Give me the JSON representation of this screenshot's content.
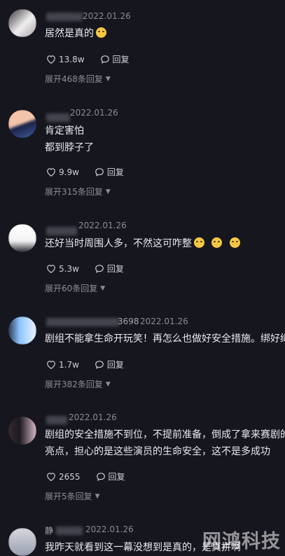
{
  "comments": [
    {
      "date": "2022.01.26",
      "text_lines": [
        "居然是真的"
      ],
      "likes": "13.8w",
      "reply_label": "回复",
      "expand_label": "展开468条回复"
    },
    {
      "date": "2022.01.26",
      "text_lines": [
        "肯定害怕",
        "都到脖子了"
      ],
      "likes": "9.9w",
      "reply_label": "回复",
      "expand_label": "展开315条回复"
    },
    {
      "date": "2022.01.26",
      "text_lines": [
        "还好当时周围人多，不然这可咋整"
      ],
      "likes": "5.3w",
      "reply_label": "回复",
      "expand_label": "展开60条回复"
    },
    {
      "name_suffix": "3698",
      "date": "2022.01.26",
      "text_lines": [
        "剧组不能拿生命开玩笑！再怎么也做好安全措施。绑好绳"
      ],
      "likes": "1.7w",
      "reply_label": "回复",
      "expand_label": "展开382条回复"
    },
    {
      "date": "2022.01.26",
      "text_lines": [
        "剧组的安全措施不到位，不提前准备，倒成了拿来赛剧的",
        "亮点，担心的是这些演员的生命安全，这不是多成功"
      ],
      "likes": "2655",
      "reply_label": "回复",
      "expand_label": "展开5条回复"
    },
    {
      "name_prefix": "静",
      "date": "2022.01.26",
      "text_lines": [
        "我昨天就看到这一幕没想到是真的，是真拼啊"
      ]
    }
  ],
  "watermark": "网鸿科技",
  "colors": {
    "background": "#16161e",
    "text": "#e9e9ee",
    "muted": "#8b8b95"
  }
}
